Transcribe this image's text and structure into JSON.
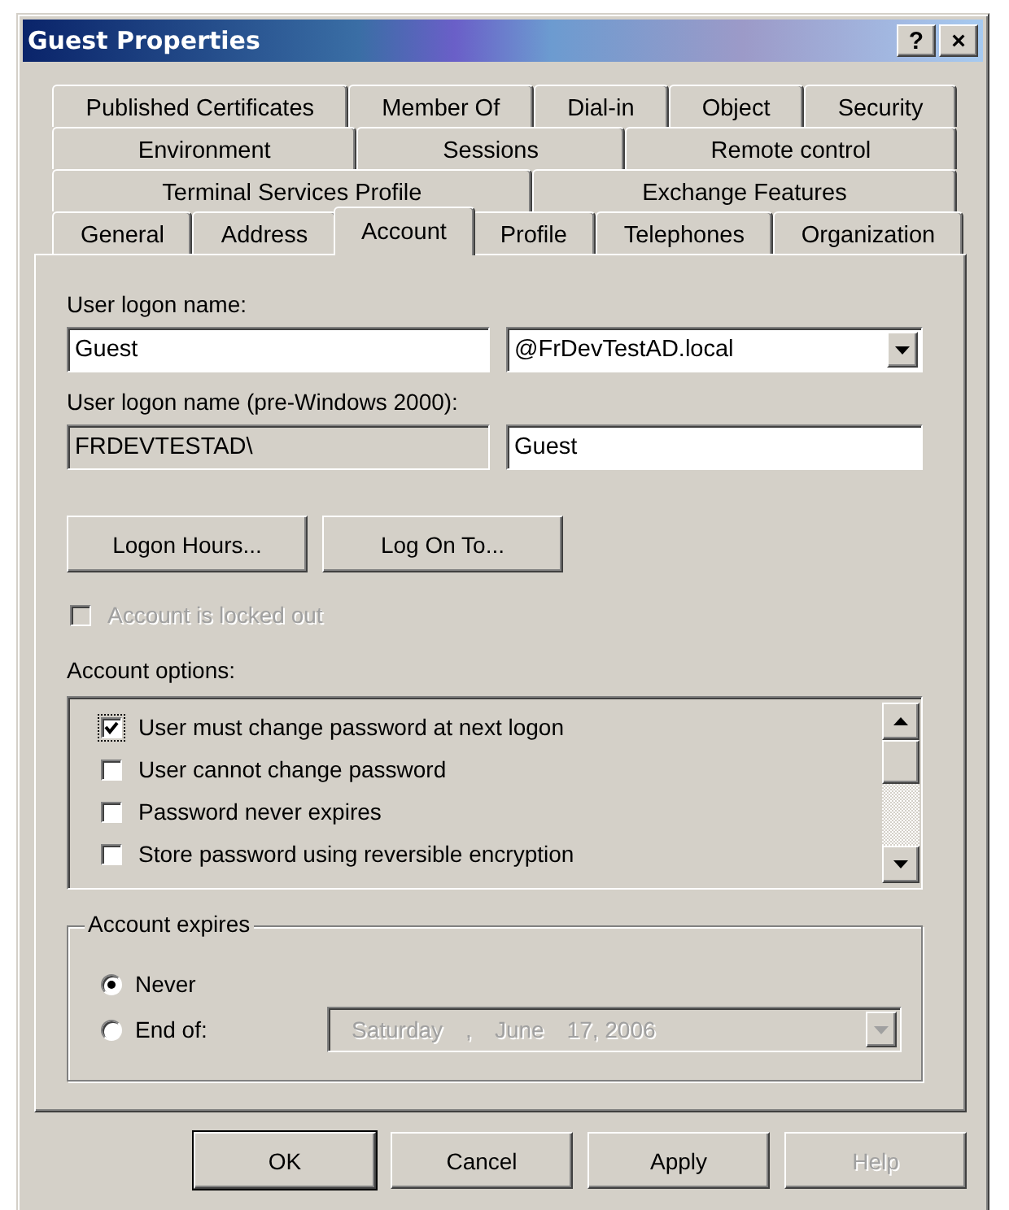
{
  "window": {
    "title": "Guest Properties",
    "help_button": "?",
    "close_button": "×"
  },
  "tab_rows": [
    [
      {
        "label": "Published Certificates",
        "selected": false
      },
      {
        "label": "Member Of",
        "selected": false
      },
      {
        "label": "Dial-in",
        "selected": false
      },
      {
        "label": "Object",
        "selected": false
      },
      {
        "label": "Security",
        "selected": false
      }
    ],
    [
      {
        "label": "Environment",
        "selected": false
      },
      {
        "label": "Sessions",
        "selected": false
      },
      {
        "label": "Remote control",
        "selected": false
      }
    ],
    [
      {
        "label": "Terminal Services Profile",
        "selected": false
      },
      {
        "label": "Exchange Features",
        "selected": false
      }
    ],
    [
      {
        "label": "General",
        "selected": false
      },
      {
        "label": "Address",
        "selected": false
      },
      {
        "label": "Account",
        "selected": true
      },
      {
        "label": "Profile",
        "selected": false
      },
      {
        "label": "Telephones",
        "selected": false
      },
      {
        "label": "Organization",
        "selected": false
      }
    ]
  ],
  "account": {
    "logon_name": {
      "label": "User logon name:",
      "value": "Guest",
      "domain": "@FrDevTestAD.local"
    },
    "pre2000": {
      "label": "User logon name (pre-Windows 2000):",
      "domain": "FRDEVTESTAD\\",
      "value": "Guest"
    },
    "buttons": [
      "Logon Hours...",
      "Log On To..."
    ],
    "locked_out": {
      "label": "Account is locked out",
      "checked": false,
      "disabled": true
    },
    "options_label": "Account options:",
    "options": [
      {
        "label": "User must change password at next logon",
        "checked": true,
        "focused": true
      },
      {
        "label": "User cannot change password",
        "checked": false,
        "focused": false
      },
      {
        "label": "Password never expires",
        "checked": false,
        "focused": false
      },
      {
        "label": "Store password using reversible encryption",
        "checked": false,
        "focused": false
      }
    ],
    "expires": {
      "legend": "Account expires",
      "choices": [
        {
          "label": "Never",
          "selected": true
        },
        {
          "label": "End of:",
          "selected": false
        }
      ],
      "date": {
        "parts": [
          "Saturday",
          ",",
          "June",
          "17, 2006"
        ],
        "disabled": true
      }
    }
  },
  "buttons": [
    {
      "label": "OK",
      "default": true,
      "disabled": false
    },
    {
      "label": "Cancel",
      "default": false,
      "disabled": false
    },
    {
      "label": "Apply",
      "default": false,
      "disabled": false
    },
    {
      "label": "Help",
      "default": false,
      "disabled": true
    }
  ]
}
